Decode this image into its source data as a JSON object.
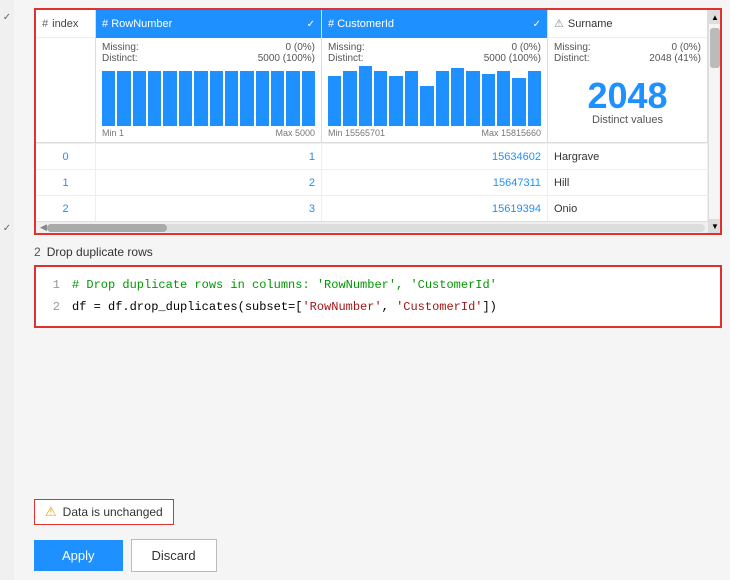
{
  "table": {
    "columns": [
      {
        "id": "index",
        "label": "index",
        "type": "index"
      },
      {
        "id": "RowNumber",
        "label": "RowNumber",
        "type": "numeric",
        "missing": "0 (0%)",
        "distinct": "5000 (100%)",
        "min": "Min 1",
        "max": "Max 5000",
        "bars": [
          55,
          55,
          55,
          55,
          55,
          55,
          55,
          55,
          55,
          55,
          55,
          55,
          55,
          55
        ]
      },
      {
        "id": "CustomerId",
        "label": "CustomerId",
        "type": "numeric",
        "missing": "0 (0%)",
        "distinct": "5000 (100%)",
        "min": "Min 15565701",
        "max": "Max 15815660",
        "bars": [
          50,
          55,
          60,
          55,
          50,
          55,
          40,
          55,
          58,
          55,
          52,
          55,
          48,
          55
        ]
      },
      {
        "id": "Surname",
        "label": "Surname",
        "type": "string",
        "missing": "0 (0%)",
        "distinct": "2048 (41%)",
        "distinct_value": "2048",
        "distinct_text": "Distinct values"
      }
    ],
    "rows": [
      {
        "index": "0",
        "RowNumber": "1",
        "CustomerId": "15634602",
        "Surname": "Hargrave"
      },
      {
        "index": "1",
        "RowNumber": "2",
        "CustomerId": "15647311",
        "Surname": "Hill"
      },
      {
        "index": "2",
        "RowNumber": "3",
        "CustomerId": "15619394",
        "Surname": "Onio"
      }
    ]
  },
  "step": {
    "number": "2",
    "label": "Drop duplicate rows"
  },
  "code": {
    "line1_num": "1",
    "line1_comment": "# Drop duplicate rows in columns: 'RowNumber', 'CustomerId'",
    "line2_num": "2",
    "line2_code": "df = df.drop_duplicates(subset=['RowNumber', 'CustomerId'])"
  },
  "status": {
    "text": "Data is unchanged"
  },
  "buttons": {
    "apply": "Apply",
    "discard": "Discard"
  },
  "labels": {
    "missing": "Missing:",
    "distinct": "Distinct:",
    "hash": "#",
    "checkmark": "✓",
    "warning": "⚠"
  }
}
